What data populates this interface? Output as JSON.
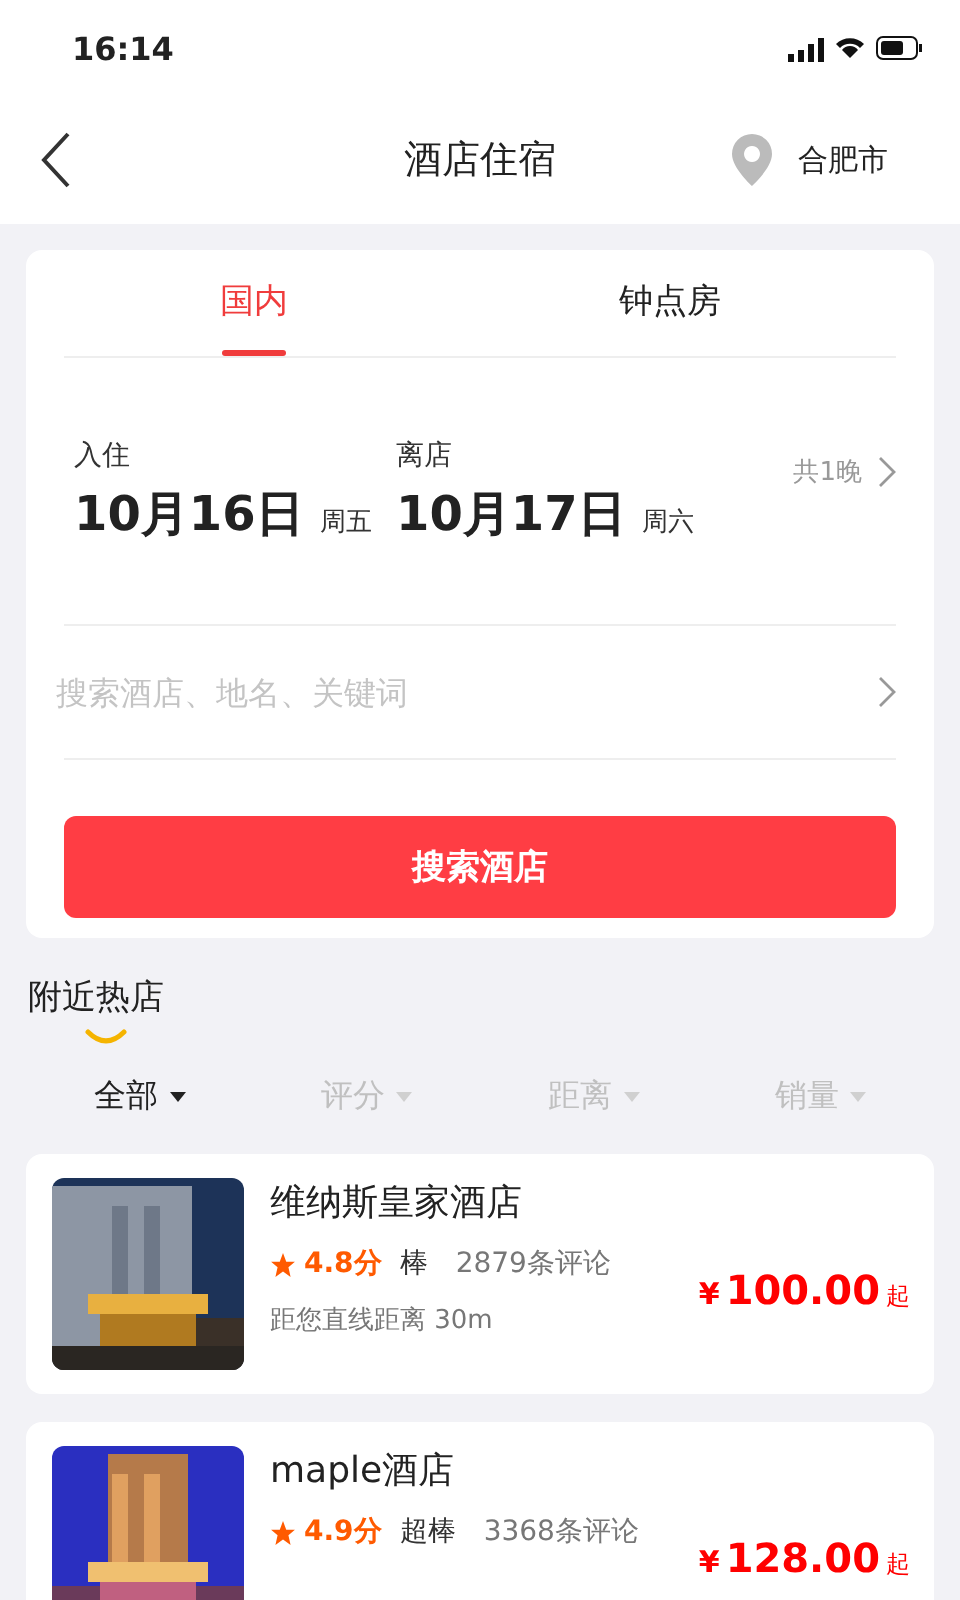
{
  "status_bar": {
    "time": "16:14"
  },
  "nav": {
    "title": "酒店住宿",
    "city": "合肥市"
  },
  "tabs": [
    {
      "label": "国内",
      "selected": true
    },
    {
      "label": "钟点房",
      "selected": false
    }
  ],
  "dates": [
    {
      "label": "入住",
      "date": "10月16日",
      "weekday": "周五"
    },
    {
      "label": "离店",
      "date": "10月17日",
      "weekday": "周六"
    }
  ],
  "nights": "共1晚",
  "search": {
    "placeholder": "搜索酒店、地名、关键词"
  },
  "search_button": "搜索酒店",
  "section_title": "附近热店",
  "filters": [
    {
      "label": "全部",
      "selected": true
    },
    {
      "label": "评分",
      "selected": false
    },
    {
      "label": "距离",
      "selected": false
    },
    {
      "label": "销量",
      "selected": false
    }
  ],
  "hotels": [
    {
      "name": "维纳斯皇家酒店",
      "score": "4.8分",
      "grade": "棒",
      "reviews": "2879条评论",
      "distance": "距您直线距离 30m",
      "currency": "¥",
      "price": "100.00",
      "suffix": "起"
    },
    {
      "name": "maple酒店",
      "score": "4.9分",
      "grade": "超棒",
      "reviews": "3368条评论",
      "currency": "¥",
      "price": "128.00",
      "suffix": "起"
    }
  ]
}
